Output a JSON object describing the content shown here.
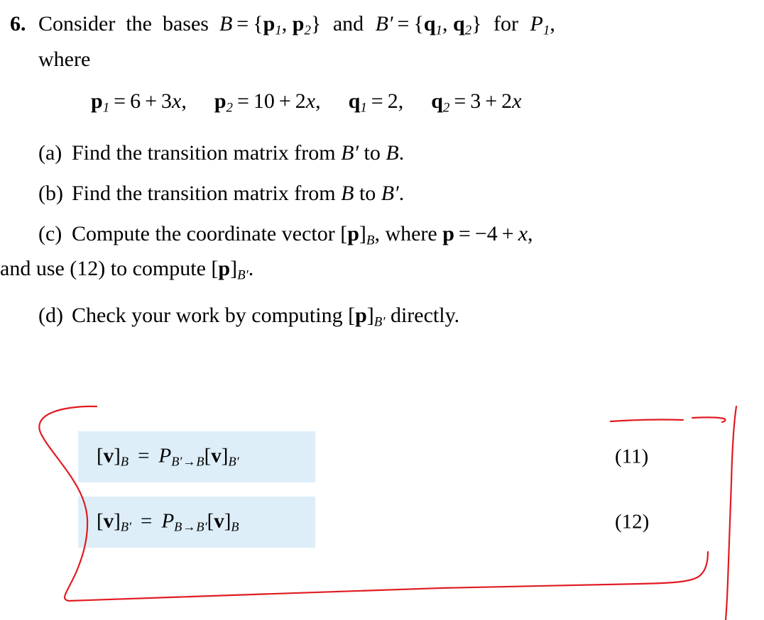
{
  "document": {
    "type": "textbook-exercise",
    "background_color": "#ffffff",
    "text_color": "#000000"
  },
  "problem": {
    "number": "6.",
    "stem_line1": "Consider the bases B = {p₁, p₂} and B′ = {q₁, q₂} for P₁,",
    "stem_line2": "where",
    "display_math": "p₁ = 6 + 3x,   p₂ = 10 + 2x,   q₁ = 2,   q₂ = 3 + 2x",
    "definitions": [
      {
        "symbol": "p",
        "index": "1",
        "expression": "6 + 3x"
      },
      {
        "symbol": "p",
        "index": "2",
        "expression": "10 + 2x"
      },
      {
        "symbol": "q",
        "index": "1",
        "expression": "2"
      },
      {
        "symbol": "q",
        "index": "2",
        "expression": "3 + 2x"
      }
    ],
    "parts": [
      {
        "label": "(a)",
        "text": "Find the transition matrix from B′ to B.",
        "lines": [
          "Find the transition matrix from B′ to B."
        ]
      },
      {
        "label": "(b)",
        "text": "Find the transition matrix from B to B′.",
        "lines": [
          "Find the transition matrix from B to B′."
        ]
      },
      {
        "label": "(c)",
        "text": "Compute the coordinate vector [p]B, where p = −4 + x, and use (12) to compute [p]B′.",
        "lines": [
          "Compute the coordinate vector [p]B, where p = −4 + x,",
          "and use (12) to compute [p]B′."
        ]
      },
      {
        "label": "(d)",
        "text": "Check your work by computing [p]B′ directly.",
        "lines": [
          "Check your work by computing [p]B′ directly."
        ]
      }
    ]
  },
  "equations": {
    "highlight_color": "#ddeef8",
    "items": [
      {
        "id": "eq11",
        "number": "(11)",
        "formula": "[v]B = PB′→B [v]B′",
        "lhs": "[v]B",
        "rhs_matrix": "P",
        "rhs_subscript": "B′→B",
        "rhs_vector": "[v]B′"
      },
      {
        "id": "eq12",
        "number": "(12)",
        "formula": "[v]B′ = PB→B′ [v]B",
        "lhs": "[v]B′",
        "rhs_matrix": "P",
        "rhs_subscript": "B→B′",
        "rhs_vector": "[v]B"
      }
    ]
  },
  "annotation": {
    "kind": "hand-drawn-highlight",
    "shape": "open-rounded-rectangle",
    "color": "#e01b22",
    "stroke_width": 2,
    "description": "Red hand-drawn loop circling equations (11) and (12)"
  }
}
